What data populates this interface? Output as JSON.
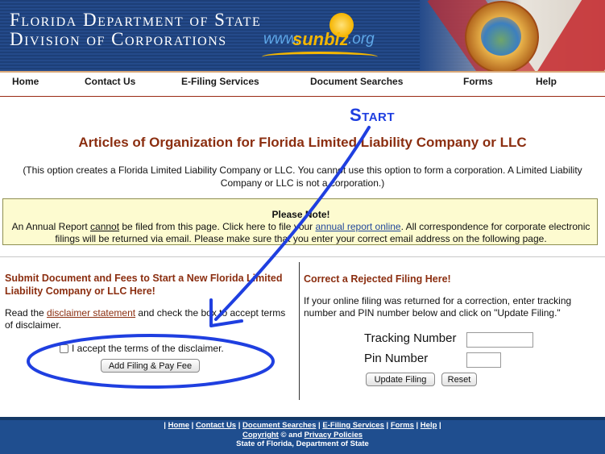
{
  "header": {
    "title_line1": "Florida Department of State",
    "title_line2": "Division of Corporations",
    "logo_www": "www.",
    "logo_sunbiz": "sunbiz",
    "logo_org": ".org"
  },
  "nav": {
    "items": [
      "Home",
      "Contact Us",
      "E-Filing Services",
      "Document Searches",
      "Forms",
      "Help"
    ]
  },
  "main": {
    "title": "Articles of Organization for Florida Limited Liability Company or LLC",
    "description": "(This option creates a Florida Limited Liability Company or LLC. You cannot use this option to form a corporation. A Limited Liability Company or LLC is not a corporation.)"
  },
  "note": {
    "title": "Please Note!",
    "body_part1": "An Annual Report ",
    "body_cannot": "cannot",
    "body_part2": " be filed from this page. Click here to file your ",
    "body_link": "annual report online",
    "body_part3": ". All correspondence for corporate electronic filings will be returned via email. Please make sure that you enter your correct email address on the following page."
  },
  "left_panel": {
    "heading": "Submit Document and Fees to Start a New Florida Limited Liability Company or LLC Here!",
    "text_part1": "Read the ",
    "text_link": "disclaimer statement",
    "text_part2": " and check the box to accept terms of disclaimer.",
    "checkbox_label": "I accept the terms of the disclaimer.",
    "submit_label": "Add Filing & Pay Fee"
  },
  "right_panel": {
    "heading": "Correct a Rejected Filing Here!",
    "text": "If your online filing was returned for a correction, enter tracking number and PIN number below and click on \"Update Filing.\"",
    "tracking_label": "Tracking Number",
    "tracking_value": "",
    "pin_label": "Pin Number",
    "pin_value": "",
    "update_label": "Update Filing",
    "reset_label": "Reset"
  },
  "footer": {
    "links": [
      "Home",
      "Contact Us",
      "Document Searches",
      "E-Filing Services",
      "Forms",
      "Help"
    ],
    "copyright": "Copyright",
    "and_text": " © and ",
    "privacy": "Privacy Policies",
    "line3": "State of Florida, Department of State"
  },
  "annotation": {
    "start_label": "Start",
    "color": "#1f3fe0"
  },
  "colors": {
    "brand_blue": "#244a8a",
    "heading_red": "#8b2e10",
    "note_bg": "#fdfbd0",
    "footer_bg": "#1f4e8f"
  }
}
